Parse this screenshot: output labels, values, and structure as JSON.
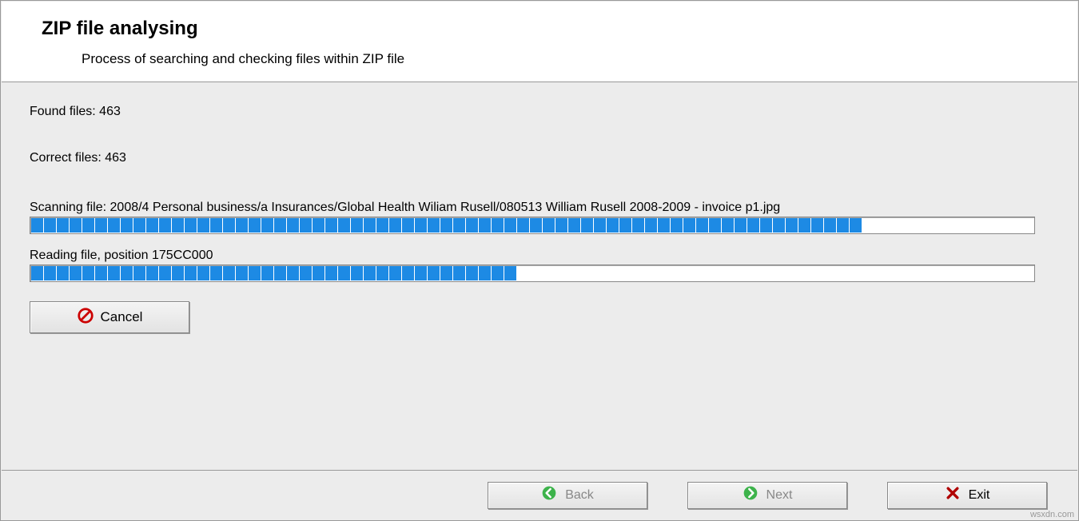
{
  "header": {
    "title": "ZIP file analysing",
    "subtitle": "Process of searching and checking files within ZIP file"
  },
  "status": {
    "found_label": "Found files:",
    "found_value": "463",
    "correct_label": "Correct files:",
    "correct_value": "463"
  },
  "scanning": {
    "label": "Scanning file:",
    "path": "2008/4 Personal business/a Insurances/Global Health Wiliam Rusell/080513 William Rusell 2008-2009 - invoice p1.jpg",
    "progress_percent": 83
  },
  "reading": {
    "label": "Reading file, position",
    "position": "175CC000",
    "progress_percent": 49
  },
  "buttons": {
    "cancel": "Cancel",
    "back": "Back",
    "next": "Next",
    "exit": "Exit"
  },
  "watermark": "wsxdn.com"
}
